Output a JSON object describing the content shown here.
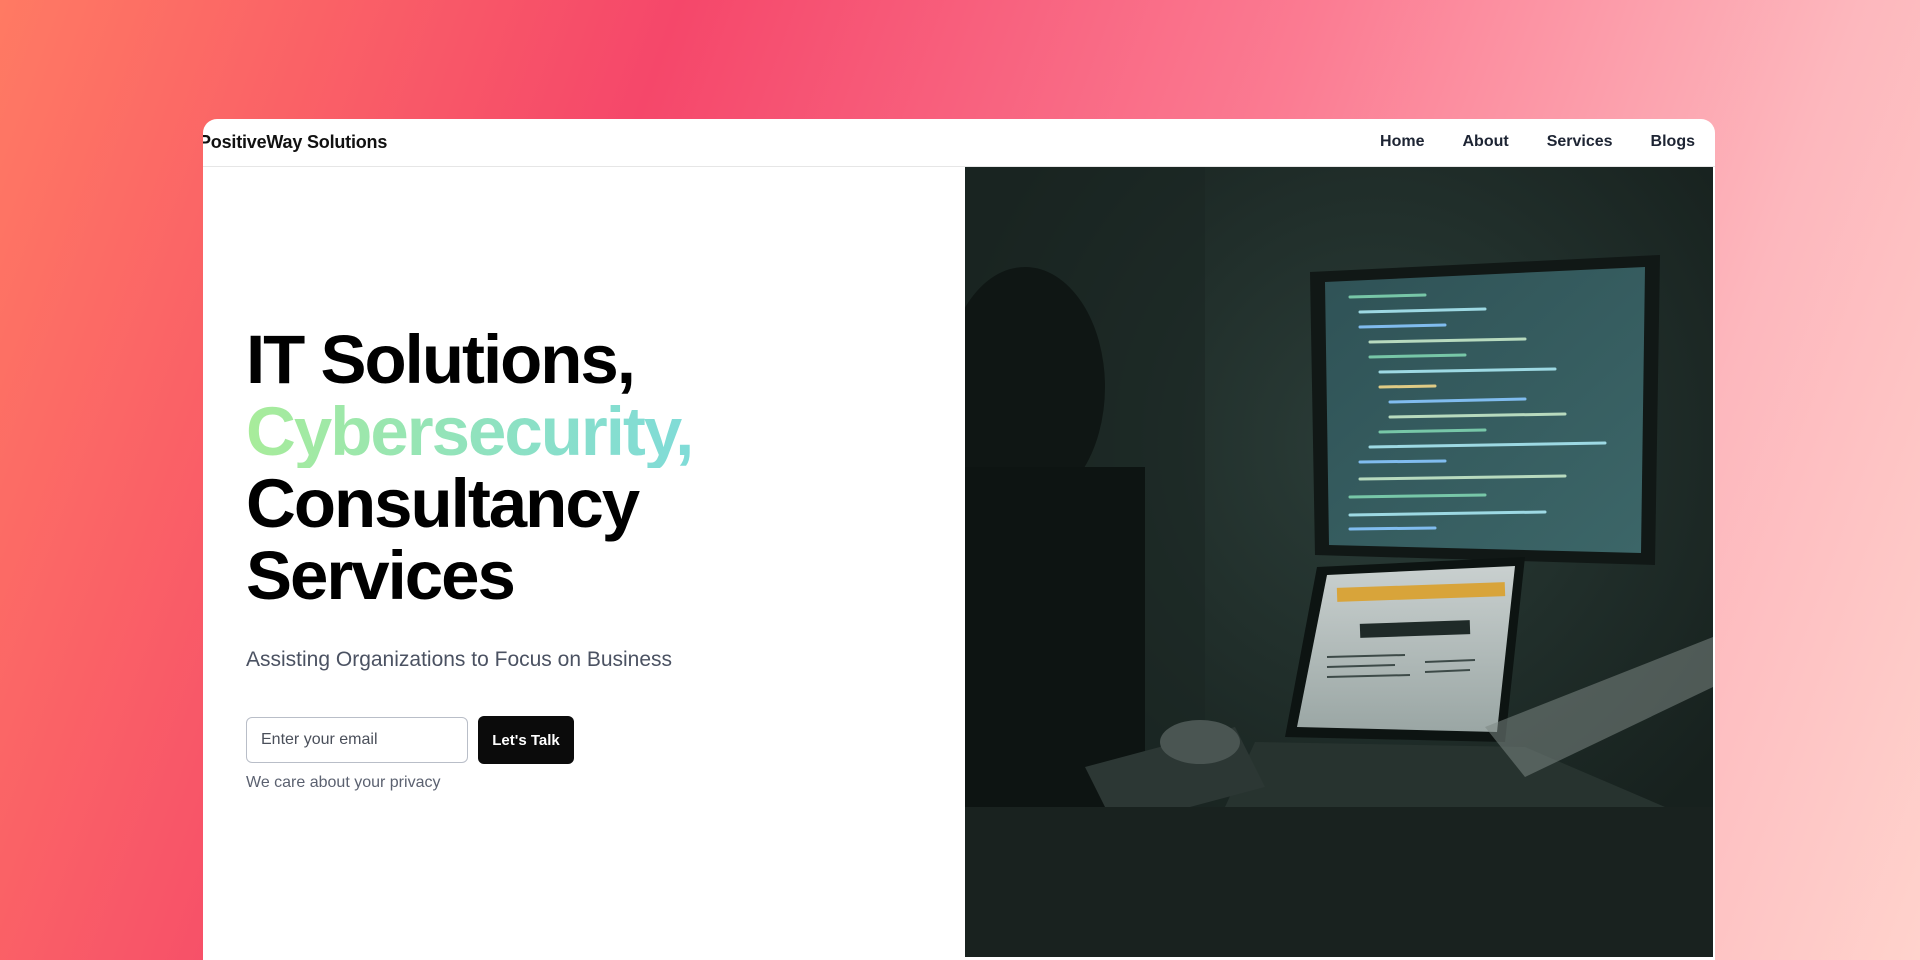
{
  "brand": "PositiveWay Solutions",
  "nav": {
    "home": "Home",
    "about": "About",
    "services": "Services",
    "blogs": "Blogs"
  },
  "hero": {
    "line1": "IT Solutions,",
    "line2": "Cybersecurity,",
    "line3": "Consultancy",
    "line4": "Services",
    "subtitle": "Assisting Organizations to Focus on Business",
    "email_placeholder": "Enter your email",
    "cta_label": "Let's Talk",
    "privacy_note": "We care about your privacy"
  },
  "colors": {
    "gradient_start": "#a8ec9a",
    "gradient_end": "#71d5f0",
    "button_bg": "#0b0b0b"
  },
  "image": {
    "subject": "person-at-computer-with-code-screens-photo"
  }
}
